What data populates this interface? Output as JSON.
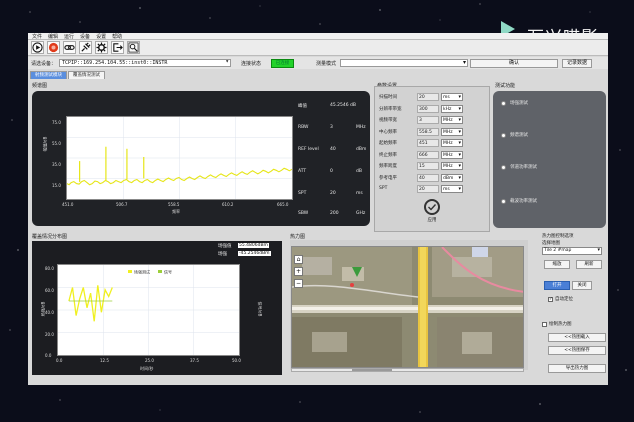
{
  "watermark": {
    "text": "万兴喵影"
  },
  "menu": [
    "文件",
    "编辑",
    "运行",
    "设备",
    "设置",
    "帮助"
  ],
  "toolbar": {
    "icons": [
      "run-icon",
      "record-icon",
      "link-icon",
      "plug-icon",
      "gear-icon",
      "export-icon",
      "zoom-icon"
    ]
  },
  "device": {
    "label": "请选设备：",
    "value": "TCPIP::169.254.104.55::inst0::INSTR",
    "status_label": "连接状态",
    "status_value": "已连接",
    "mode_label": "测量模式",
    "mode_value": "",
    "confirm_button": "确认",
    "record_button": "记录数据"
  },
  "tabs": [
    {
      "label": "射频测试模块",
      "active": true
    },
    {
      "label": "覆盖情况测试",
      "active": false
    }
  ],
  "spectrum": {
    "group_title": "频谱图",
    "readout": [
      {
        "key": "峰值",
        "value": "45.2546 dB",
        "unit": ""
      },
      {
        "key": "RBW",
        "value": "3",
        "unit": "MHz"
      },
      {
        "key": "REF level",
        "value": "40",
        "unit": "dBm"
      },
      {
        "key": "ATT",
        "value": "0",
        "unit": "dB"
      },
      {
        "key": "SPT",
        "value": "20",
        "unit": "ms"
      },
      {
        "key": "SBW",
        "value": "200",
        "unit": "GHz"
      }
    ]
  },
  "params": {
    "group_title": "参数设置",
    "rows": [
      {
        "key": "扫描时间",
        "value": "20",
        "unit": "ms"
      },
      {
        "key": "分辨率带宽",
        "value": "300",
        "unit": "kHz"
      },
      {
        "key": "视频带宽",
        "value": "3",
        "unit": "MHz"
      },
      {
        "key": "中心频率",
        "value": "558.5",
        "unit": "MHz"
      },
      {
        "key": "起始频率",
        "value": "451",
        "unit": "MHz"
      },
      {
        "key": "终止频率",
        "value": "666",
        "unit": "MHz"
      },
      {
        "key": "频率跨度",
        "value": "15",
        "unit": "MHz"
      },
      {
        "key": "参考电平",
        "value": "40",
        "unit": "dBm"
      },
      {
        "key": "SPT",
        "value": "20",
        "unit": "ms"
      }
    ],
    "apply_label": "应用"
  },
  "tests": {
    "group_title": "测试功能",
    "options": [
      "场强测试",
      "频谱测试",
      "邻道功率测试",
      "载波功率测试"
    ]
  },
  "coverage": {
    "group_title": "覆盖情况分布图",
    "readout_label1": "场强值",
    "readout_value1": "55.4806dBm",
    "readout_label2": "场强",
    "readout_value2": "-45.2546dBm"
  },
  "map": {
    "group_title": "热力图"
  },
  "controls": {
    "group_title": "热力图控制选项",
    "select_label": "选择地图",
    "select_value": "Tile 2 #map",
    "btn_zoom": "缩放",
    "btn_reset": "刷新",
    "btn_open": "打开",
    "btn_close": "关闭",
    "check_auto": "自动定位",
    "check_heat": "绘制热力图",
    "btn_import": "<<热图载入",
    "btn_export": "<<热图保存",
    "btn_convert": "导出热力图"
  },
  "chart_data": [
    {
      "type": "line",
      "title": "",
      "xlabel": "频率",
      "ylabel": "幅值/dB",
      "x_ticks": [
        "451.0",
        "506.7",
        "558.5",
        "610.2",
        "665.0"
      ],
      "y_ticks": [
        "75.0",
        "55.0",
        "35.0",
        "15.0"
      ],
      "xlim": [
        451,
        665
      ],
      "ylim": [
        5,
        85
      ],
      "grid": true,
      "series": [
        {
          "x": [
            451,
            455,
            460,
            465,
            470,
            475,
            480,
            485,
            490,
            495,
            500,
            505,
            510,
            515,
            520,
            525,
            530,
            535,
            540,
            545,
            550,
            555,
            560,
            565,
            570,
            575,
            580,
            585,
            590,
            595,
            600,
            605,
            610,
            615,
            620,
            625,
            630,
            635,
            640,
            645,
            650,
            655,
            660,
            665
          ],
          "values": [
            20,
            21,
            20,
            22,
            21,
            20,
            22,
            21,
            22,
            21,
            22,
            23,
            22,
            23,
            22,
            23,
            22,
            23,
            23,
            24,
            24,
            25,
            24,
            25,
            25,
            26,
            26,
            27,
            27,
            28,
            28,
            29,
            29,
            30,
            30,
            31,
            31,
            31,
            32,
            32,
            33,
            33,
            34,
            34
          ],
          "spikes": [
            {
              "x": 463,
              "y": 42
            },
            {
              "x": 488,
              "y": 56
            },
            {
              "x": 508,
              "y": 54
            },
            {
              "x": 524,
              "y": 46
            }
          ]
        }
      ]
    },
    {
      "type": "line",
      "title": "",
      "legend": [
        "场强测试",
        "信号"
      ],
      "xlabel": "时间/秒",
      "ylabel": "场强/dB",
      "y2label": "信号/dB",
      "x_ticks": [
        "0.0",
        "12.5",
        "25.0",
        "37.5",
        "50.0"
      ],
      "y_ticks": [
        "80.0",
        "60.0",
        "40.0",
        "20.0",
        "0.0"
      ],
      "xlim": [
        0,
        50
      ],
      "ylim": [
        0,
        80
      ],
      "grid": true,
      "series": [
        {
          "name": "场强测试",
          "x": [
            3,
            4,
            5,
            6,
            7,
            8,
            9,
            10,
            11,
            12,
            13,
            14,
            15
          ],
          "values": [
            48,
            60,
            35,
            50,
            60,
            42,
            55,
            30,
            62,
            38,
            58,
            52,
            60
          ]
        },
        {
          "name": "信号",
          "x": [
            3,
            4,
            5,
            6,
            7,
            8,
            9,
            10,
            11,
            12,
            13,
            14,
            15
          ],
          "values": [
            48,
            48,
            48,
            48,
            48,
            48,
            48,
            48,
            48,
            48,
            48,
            48,
            48
          ]
        }
      ]
    }
  ]
}
